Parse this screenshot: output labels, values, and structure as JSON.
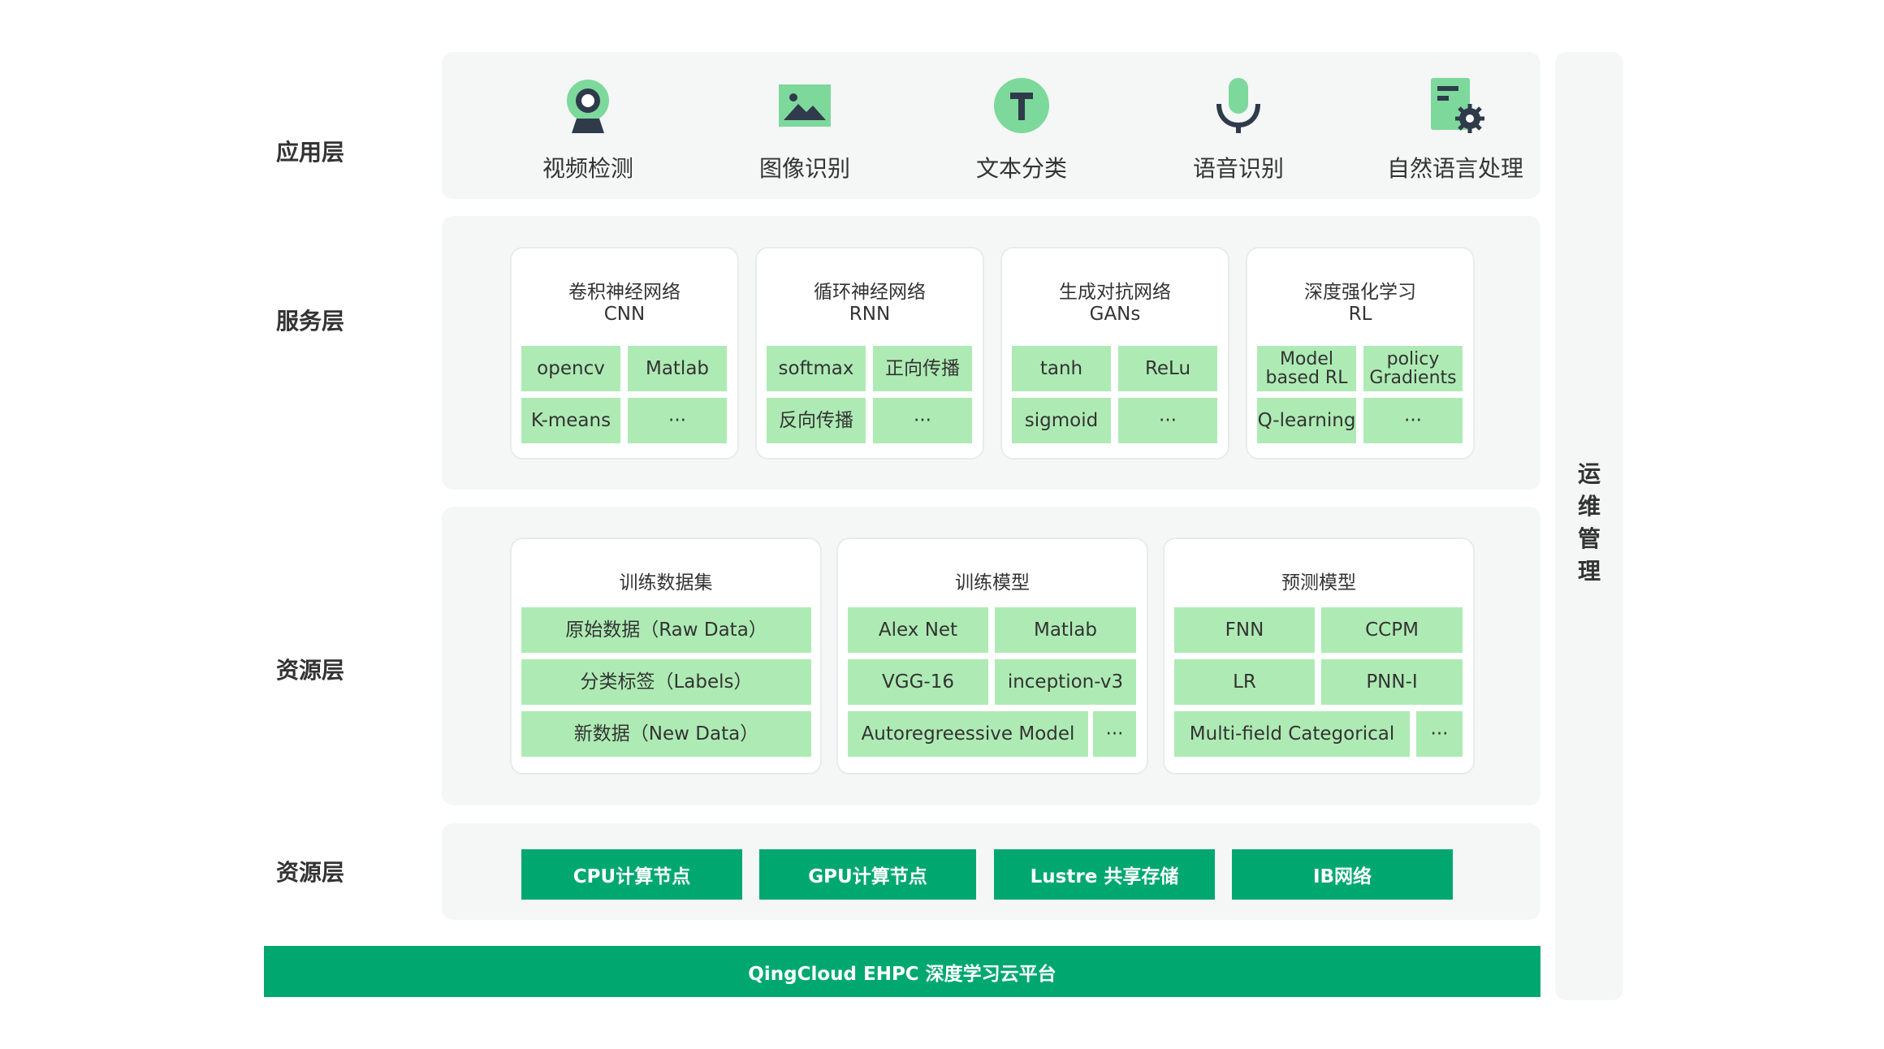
{
  "layers": {
    "application": "应用层",
    "service": "服务层",
    "resource": "资源层",
    "infrastructure": "资源层"
  },
  "applications": [
    {
      "label": "视频检测",
      "icon": "webcam-icon"
    },
    {
      "label": "图像识别",
      "icon": "image-icon"
    },
    {
      "label": "文本分类",
      "icon": "text-icon"
    },
    {
      "label": "语音识别",
      "icon": "microphone-icon"
    },
    {
      "label": "自然语言处理",
      "icon": "document-gear-icon"
    }
  ],
  "services": [
    {
      "title": "卷积神经网络",
      "subtitle": "CNN",
      "cells": [
        "opencv",
        "Matlab",
        "K-means",
        "···"
      ]
    },
    {
      "title": "循环神经网络",
      "subtitle": "RNN",
      "cells": [
        "softmax",
        "正向传播",
        "反向传播",
        "···"
      ]
    },
    {
      "title": "生成对抗网络",
      "subtitle": "GANs",
      "cells": [
        "tanh",
        "ReLu",
        "sigmoid",
        "···"
      ]
    },
    {
      "title": "深度强化学习",
      "subtitle": "RL",
      "cells": [
        "Model\nbased RL",
        "policy\nGradients",
        "Q-learning",
        "···"
      ]
    }
  ],
  "resources": {
    "dataset": {
      "title": "训练数据集",
      "cells": [
        "原始数据（Raw Data）",
        "分类标签（Labels）",
        "新数据（New Data）"
      ]
    },
    "training_model": {
      "title": "训练模型",
      "cells": [
        "Alex Net",
        "Matlab",
        "VGG-16",
        "inception-v3",
        "Autoregreessive Model",
        "···"
      ]
    },
    "prediction_model": {
      "title": "预测模型",
      "cells": [
        "FNN",
        "CCPM",
        "LR",
        "PNN-I",
        "Multi-field Categorical",
        "···"
      ]
    }
  },
  "infrastructure": [
    "CPU计算节点",
    "GPU计算节点",
    "Lustre 共享存储",
    "IB网络"
  ],
  "platform": "QingCloud EHPC 深度学习云平台",
  "operations": "运维管理",
  "colors": {
    "accent": "#00a870",
    "cell": "#aeebb4",
    "panel": "#f4f7f6",
    "icon": "#7dd89c",
    "icon_dark": "#2f3a4a"
  }
}
